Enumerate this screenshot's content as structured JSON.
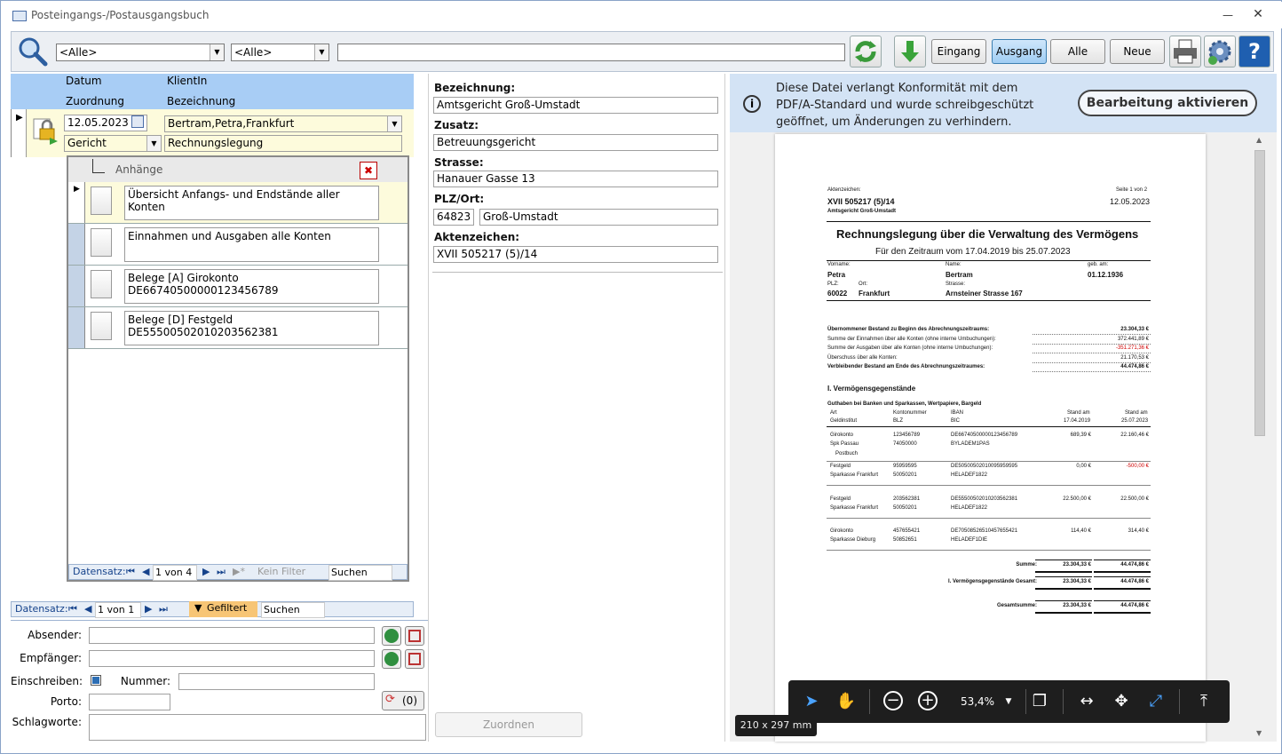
{
  "window": {
    "title": "Posteingangs-/Postausgangsbuch"
  },
  "toolbar": {
    "filter1": "<Alle>",
    "filter2": "<Alle>",
    "search_value": "",
    "buttons": {
      "eingang": "Eingang",
      "ausgang": "Ausgang",
      "alle": "Alle",
      "neue": "Neue"
    }
  },
  "list_header": {
    "col1_top": "Datum",
    "col1_bottom": "Zuordnung",
    "col2_top": "KlientIn",
    "col2_bottom": "Bezeichnung"
  },
  "record": {
    "datum": "12.05.2023",
    "klient": "Bertram,Petra,Frankfurt",
    "zuordnung": "Gericht",
    "bezeichnung": "Rechnungslegung"
  },
  "attachments": {
    "title": "Anhänge",
    "items": [
      {
        "label": "Übersicht Anfangs- und Endstände aller Konten"
      },
      {
        "label": "Einnahmen und Ausgaben alle Konten"
      },
      {
        "label": "Belege [A] Girokonto DE66740500000123456789"
      },
      {
        "label": "Belege [D] Festgeld DE55500502010203562381"
      }
    ],
    "nav": {
      "label": "Datensatz:",
      "position": "1 von 4",
      "filter": "Kein Filter",
      "search": "Suchen"
    }
  },
  "main_nav": {
    "label": "Datensatz:",
    "position": "1 von 1",
    "filter": "Gefiltert",
    "search": "Suchen"
  },
  "form": {
    "absender_label": "Absender:",
    "absender": "",
    "empfaenger_label": "Empfänger:",
    "empfaenger": "",
    "einschreiben_label": "Einschreiben:",
    "nummer_label": "Nummer:",
    "nummer": "",
    "porto_label": "Porto:",
    "porto": "",
    "counter": "(0)",
    "schlagworte_label": "Schlagworte:",
    "schlagworte": ""
  },
  "address": {
    "bezeichnung_label": "Bezeichnung:",
    "bezeichnung": "Amtsgericht Groß-Umstadt",
    "zusatz_label": "Zusatz:",
    "zusatz": "Betreuungsgericht",
    "strasse_label": "Strasse:",
    "strasse": "Hanauer Gasse 13",
    "plzort_label": "PLZ/Ort:",
    "plz": "64823",
    "ort": "Groß-Umstadt",
    "aktenzeichen_label": "Aktenzeichen:",
    "aktenzeichen": "XVII 505217 (5)/14",
    "zuordnen_button": "Zuordnen"
  },
  "viewer": {
    "info_text": "Diese Datei verlangt Konformität mit dem PDF/A-Standard und wurde schreibgeschützt geöffnet, um Änderungen zu verhindern.",
    "edit_button": "Bearbeitung aktivieren",
    "zoom": "53,4%",
    "page_size": "210 x 297 mm"
  },
  "document": {
    "aktenzeichen_label": "Aktenzeichen:",
    "aktenzeichen": "XVII 505217 (5)/14",
    "gericht": "Amtsgericht Groß-Umstadt",
    "seite": "Seite 1 von 2",
    "datum": "12.05.2023",
    "title": "Rechnungslegung über die Verwaltung des Vermögens",
    "subtitle": "Für den Zeitraum vom 17.04.2019 bis 25.07.2023",
    "person": {
      "vorname_label": "Vorname:",
      "vorname": "Petra",
      "name_label": "Name:",
      "name": "Bertram",
      "geb_label": "geb. am:",
      "geb": "01.12.1936",
      "plz_label": "PLZ:",
      "ort_label": "Ort:",
      "strasse_label": "Strasse:",
      "plz": "60022",
      "ort": "Frankfurt",
      "strasse": "Arnsteiner Strasse 167"
    },
    "summary": [
      {
        "label": "Übernommener Bestand zu Beginn des Abrechnungszeitraums:",
        "value": "23.304,33 €"
      },
      {
        "label": "Summe der Einnahmen über alle Konten (ohne interne Umbuchungen):",
        "value": "372.441,89 €"
      },
      {
        "label": "Summe der Ausgaben über alle Konten (ohne interne Umbuchungen):",
        "value": "-351.271,36 €"
      },
      {
        "label": "Überschuss über alle Konten:",
        "value": "21.170,53 €"
      },
      {
        "label": "Verbleibender Bestand am Ende des Abrechnungszeitraumes:",
        "value": "44.474,86 €"
      }
    ],
    "section_title": "I. Vermögensgegenstände",
    "subsection_title": "Guthaben bei Banken und Sparkassen, Wertpapiere, Bargeld",
    "table_header": {
      "art": "Art",
      "institut": "Geldinstitut",
      "kontonr": "Kontonummer",
      "blz": "BLZ",
      "iban": "IBAN",
      "bic": "BIC",
      "stand1": "Stand am",
      "stand1_date": "17.04.2019",
      "stand2": "Stand am",
      "stand2_date": "25.07.2023"
    },
    "accounts": [
      {
        "art": "Girokonto",
        "institut": "Spk Passau",
        "extra": "Postbuch",
        "kontonr": "123456789",
        "blz": "74050000",
        "iban": "DE66740500000123456789",
        "bic": "BYLADEM1PAS",
        "stand1": "689,39 €",
        "stand2": "22.160,46 €"
      },
      {
        "art": "Festgeld",
        "institut": "Sparkasse Frankfurt",
        "kontonr": "95959595",
        "blz": "50050201",
        "iban": "DE50500502010095959595",
        "bic": "HELADEF1822",
        "stand1": "0,00 €",
        "stand2": "-500,00 €"
      },
      {
        "art": "Festgeld",
        "institut": "Sparkasse Frankfurt",
        "kontonr": "203562381",
        "blz": "50050201",
        "iban": "DE55500502010203562381",
        "bic": "HELADEF1822",
        "stand1": "22.500,00 €",
        "stand2": "22.500,00 €"
      },
      {
        "art": "Girokonto",
        "institut": "Sparkasse Dieburg",
        "kontonr": "457655421",
        "blz": "50852651",
        "iban": "DE70508526510457655421",
        "bic": "HELADEF1DIE",
        "stand1": "114,40 €",
        "stand2": "314,40 €"
      }
    ],
    "totals": [
      {
        "label": "Summe:",
        "v1": "23.304,33 €",
        "v2": "44.474,86 €"
      },
      {
        "label": "I. Vermögensgegenstände  Gesamt:",
        "v1": "23.304,33 €",
        "v2": "44.474,86 €"
      },
      {
        "label": "Gesamtsumme:",
        "v1": "23.304,33 €",
        "v2": "44.474,86 €"
      }
    ]
  },
  "colors": {
    "header_blue": "#a8cdf5",
    "field_yellow": "#fdfbdc",
    "active_blue": "#9fcdf3",
    "info_bar": "#d3e3f5",
    "floatbar": "#1e1e1e",
    "negative_red": "#d00000"
  }
}
